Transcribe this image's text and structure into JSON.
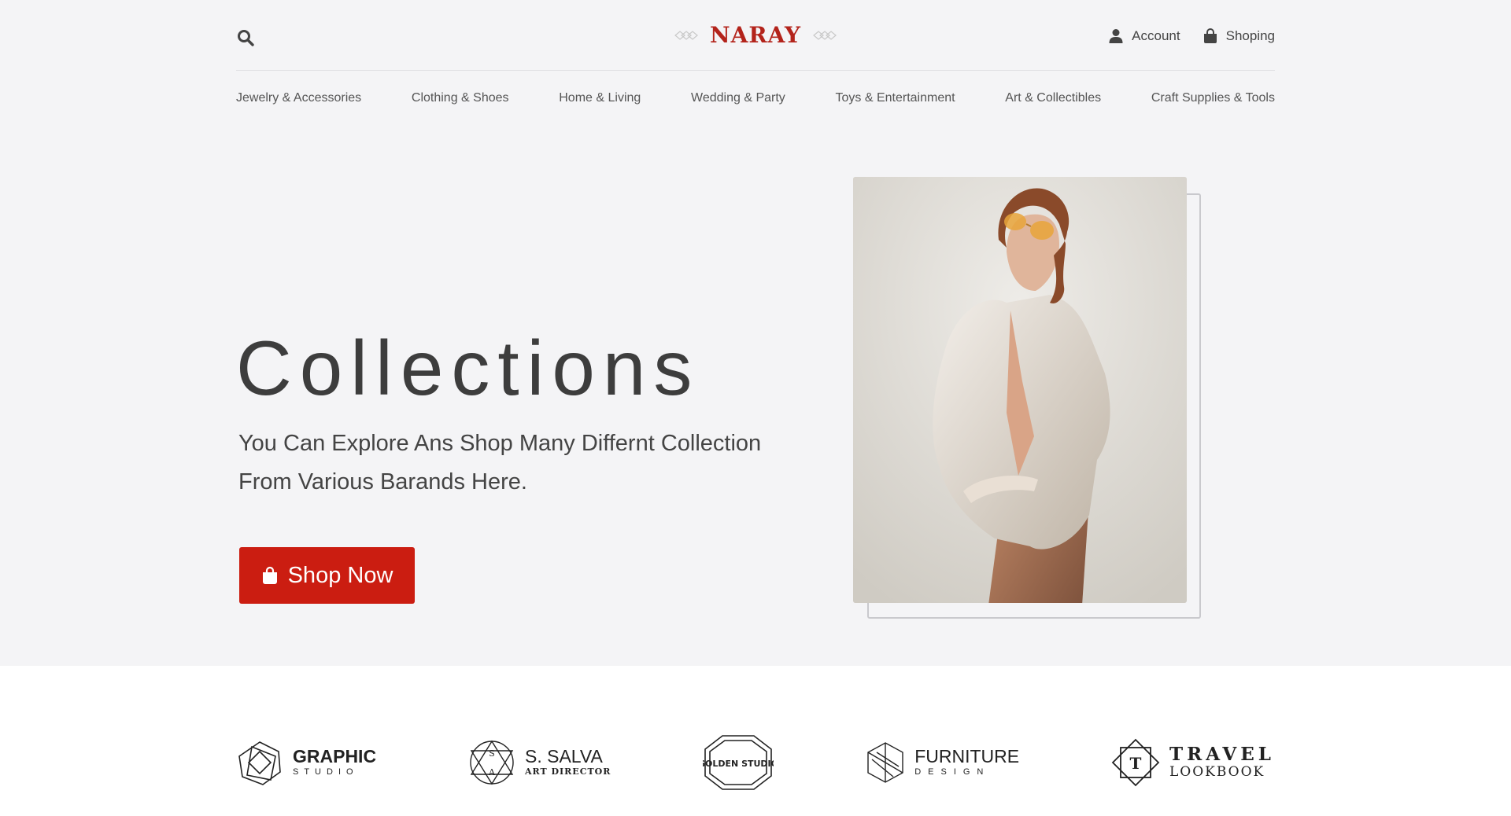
{
  "header": {
    "logo": "NARAY",
    "account_label": "Account",
    "shopping_label": "Shoping"
  },
  "nav": {
    "items": [
      {
        "label": "Jewelry & Accessories"
      },
      {
        "label": "Clothing & Shoes"
      },
      {
        "label": "Home & Living"
      },
      {
        "label": "Wedding & Party"
      },
      {
        "label": "Toys & Entertainment"
      },
      {
        "label": "Art & Collectibles"
      },
      {
        "label": "Craft Supplies & Tools"
      }
    ]
  },
  "hero": {
    "title": "Collections",
    "subtitle": "You Can Explore Ans Shop Many Differnt Collection From Various Barands Here.",
    "button_label": "Shop Now"
  },
  "brands": [
    {
      "line1": "GRAPHIC",
      "line2": "STUDIO",
      "icon": "polygon-icon"
    },
    {
      "line1": "S. SALVA",
      "line2": "ART DIRECTOR",
      "icon": "sa-monogram-icon"
    },
    {
      "line1": "GOLDEN STUDIO",
      "line2": "",
      "icon": "octagon-badge-icon"
    },
    {
      "line1": "FURNITURE",
      "line2": "DESIGN",
      "icon": "cube-icon"
    },
    {
      "line1": "TRAVEL",
      "line2": "LOOKBOOK",
      "icon": "diamond-t-icon"
    }
  ],
  "colors": {
    "accent": "#cb1d11",
    "logo": "#b3231b",
    "hero_bg": "#f4f4f6"
  }
}
